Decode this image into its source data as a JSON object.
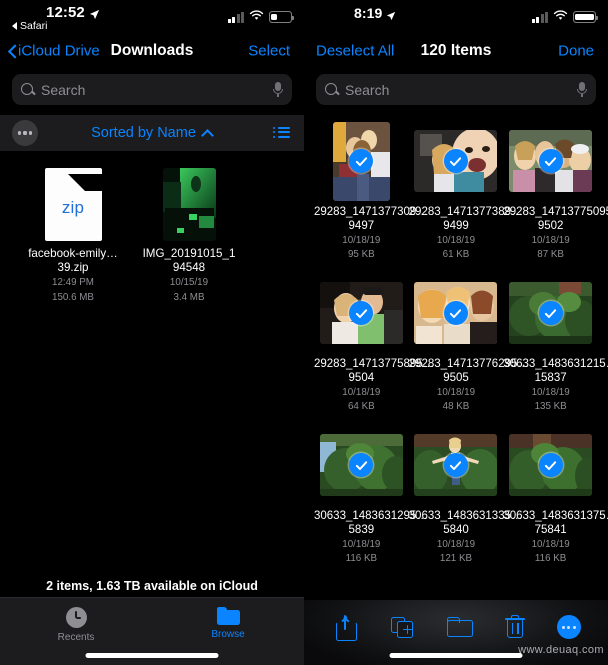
{
  "left": {
    "status": {
      "time": "12:52",
      "back_app": "Safari",
      "location_icon": "location-arrow-icon",
      "cellular_icon": "cellular-bars-icon",
      "wifi_icon": "wifi-icon",
      "battery_icon": "battery-low-icon",
      "battery_level": 30
    },
    "nav": {
      "back_label": "iCloud Drive",
      "title": "Downloads",
      "action_label": "Select"
    },
    "search": {
      "placeholder": "Search",
      "value": "",
      "mic_icon": "microphone-icon",
      "search_icon": "search-icon"
    },
    "sortbar": {
      "more_icon": "ellipsis-icon",
      "label": "Sorted by Name",
      "chevron_icon": "chevron-up-icon",
      "view_icon": "list-view-icon"
    },
    "files": [
      {
        "name": "facebook-emily…39.zip",
        "date": "12:49 PM",
        "size": "150.6 MB",
        "kind": "zip",
        "badge": "zip"
      },
      {
        "name": "IMG_20191015_194548",
        "date": "10/15/19",
        "size": "3.4 MB",
        "kind": "image"
      }
    ],
    "footer_status": "2 items, 1.63 TB available on iCloud",
    "tabs": [
      {
        "label": "Recents",
        "icon": "clock-icon",
        "active": false
      },
      {
        "label": "Browse",
        "icon": "folder-icon",
        "active": true
      }
    ]
  },
  "right": {
    "status": {
      "time": "8:19",
      "location_icon": "location-arrow-icon",
      "cellular_icon": "cellular-bars-icon",
      "wifi_icon": "wifi-icon",
      "battery_icon": "battery-full-icon",
      "battery_level": 100
    },
    "nav": {
      "left_label": "Deselect All",
      "title": "120 Items",
      "right_label": "Done"
    },
    "search": {
      "placeholder": "Search",
      "value": "",
      "mic_icon": "microphone-icon",
      "search_icon": "search-icon"
    },
    "photos": [
      {
        "name": "29283_1471377309…9497",
        "date": "10/18/19",
        "size": "95 KB",
        "selected": true,
        "orient": "portrait"
      },
      {
        "name": "29283_1471377389…9499",
        "date": "10/18/19",
        "size": "61 KB",
        "selected": true,
        "orient": "land"
      },
      {
        "name": "29283_14713775095…9502",
        "date": "10/18/19",
        "size": "87 KB",
        "selected": true,
        "orient": "land"
      },
      {
        "name": "29283_14713775895…9504",
        "date": "10/18/19",
        "size": "64 KB",
        "selected": true,
        "orient": "land"
      },
      {
        "name": "29283_14713776295…9505",
        "date": "10/18/19",
        "size": "48 KB",
        "selected": true,
        "orient": "land"
      },
      {
        "name": "30633_1483631215…15837",
        "date": "10/18/19",
        "size": "135 KB",
        "selected": true,
        "orient": "land"
      },
      {
        "name": "30633_1483631295…5839",
        "date": "10/18/19",
        "size": "116 KB",
        "selected": true,
        "orient": "land"
      },
      {
        "name": "30633_1483631335…5840",
        "date": "10/18/19",
        "size": "121 KB",
        "selected": true,
        "orient": "land"
      },
      {
        "name": "30633_1483631375…75841",
        "date": "10/18/19",
        "size": "116 KB",
        "selected": true,
        "orient": "land"
      }
    ],
    "toolbar": [
      {
        "label": "Share",
        "icon": "share-icon"
      },
      {
        "label": "Duplicate",
        "icon": "duplicate-icon"
      },
      {
        "label": "Move",
        "icon": "folder-icon"
      },
      {
        "label": "Delete",
        "icon": "trash-icon"
      },
      {
        "label": "More",
        "icon": "ellipsis-circle-icon"
      }
    ],
    "watermark": "www.deuaq.com"
  },
  "colors": {
    "accent": "#0a84ff",
    "bg": "#000000",
    "panel": "#1c1c1e",
    "muted": "#8e8e93"
  }
}
